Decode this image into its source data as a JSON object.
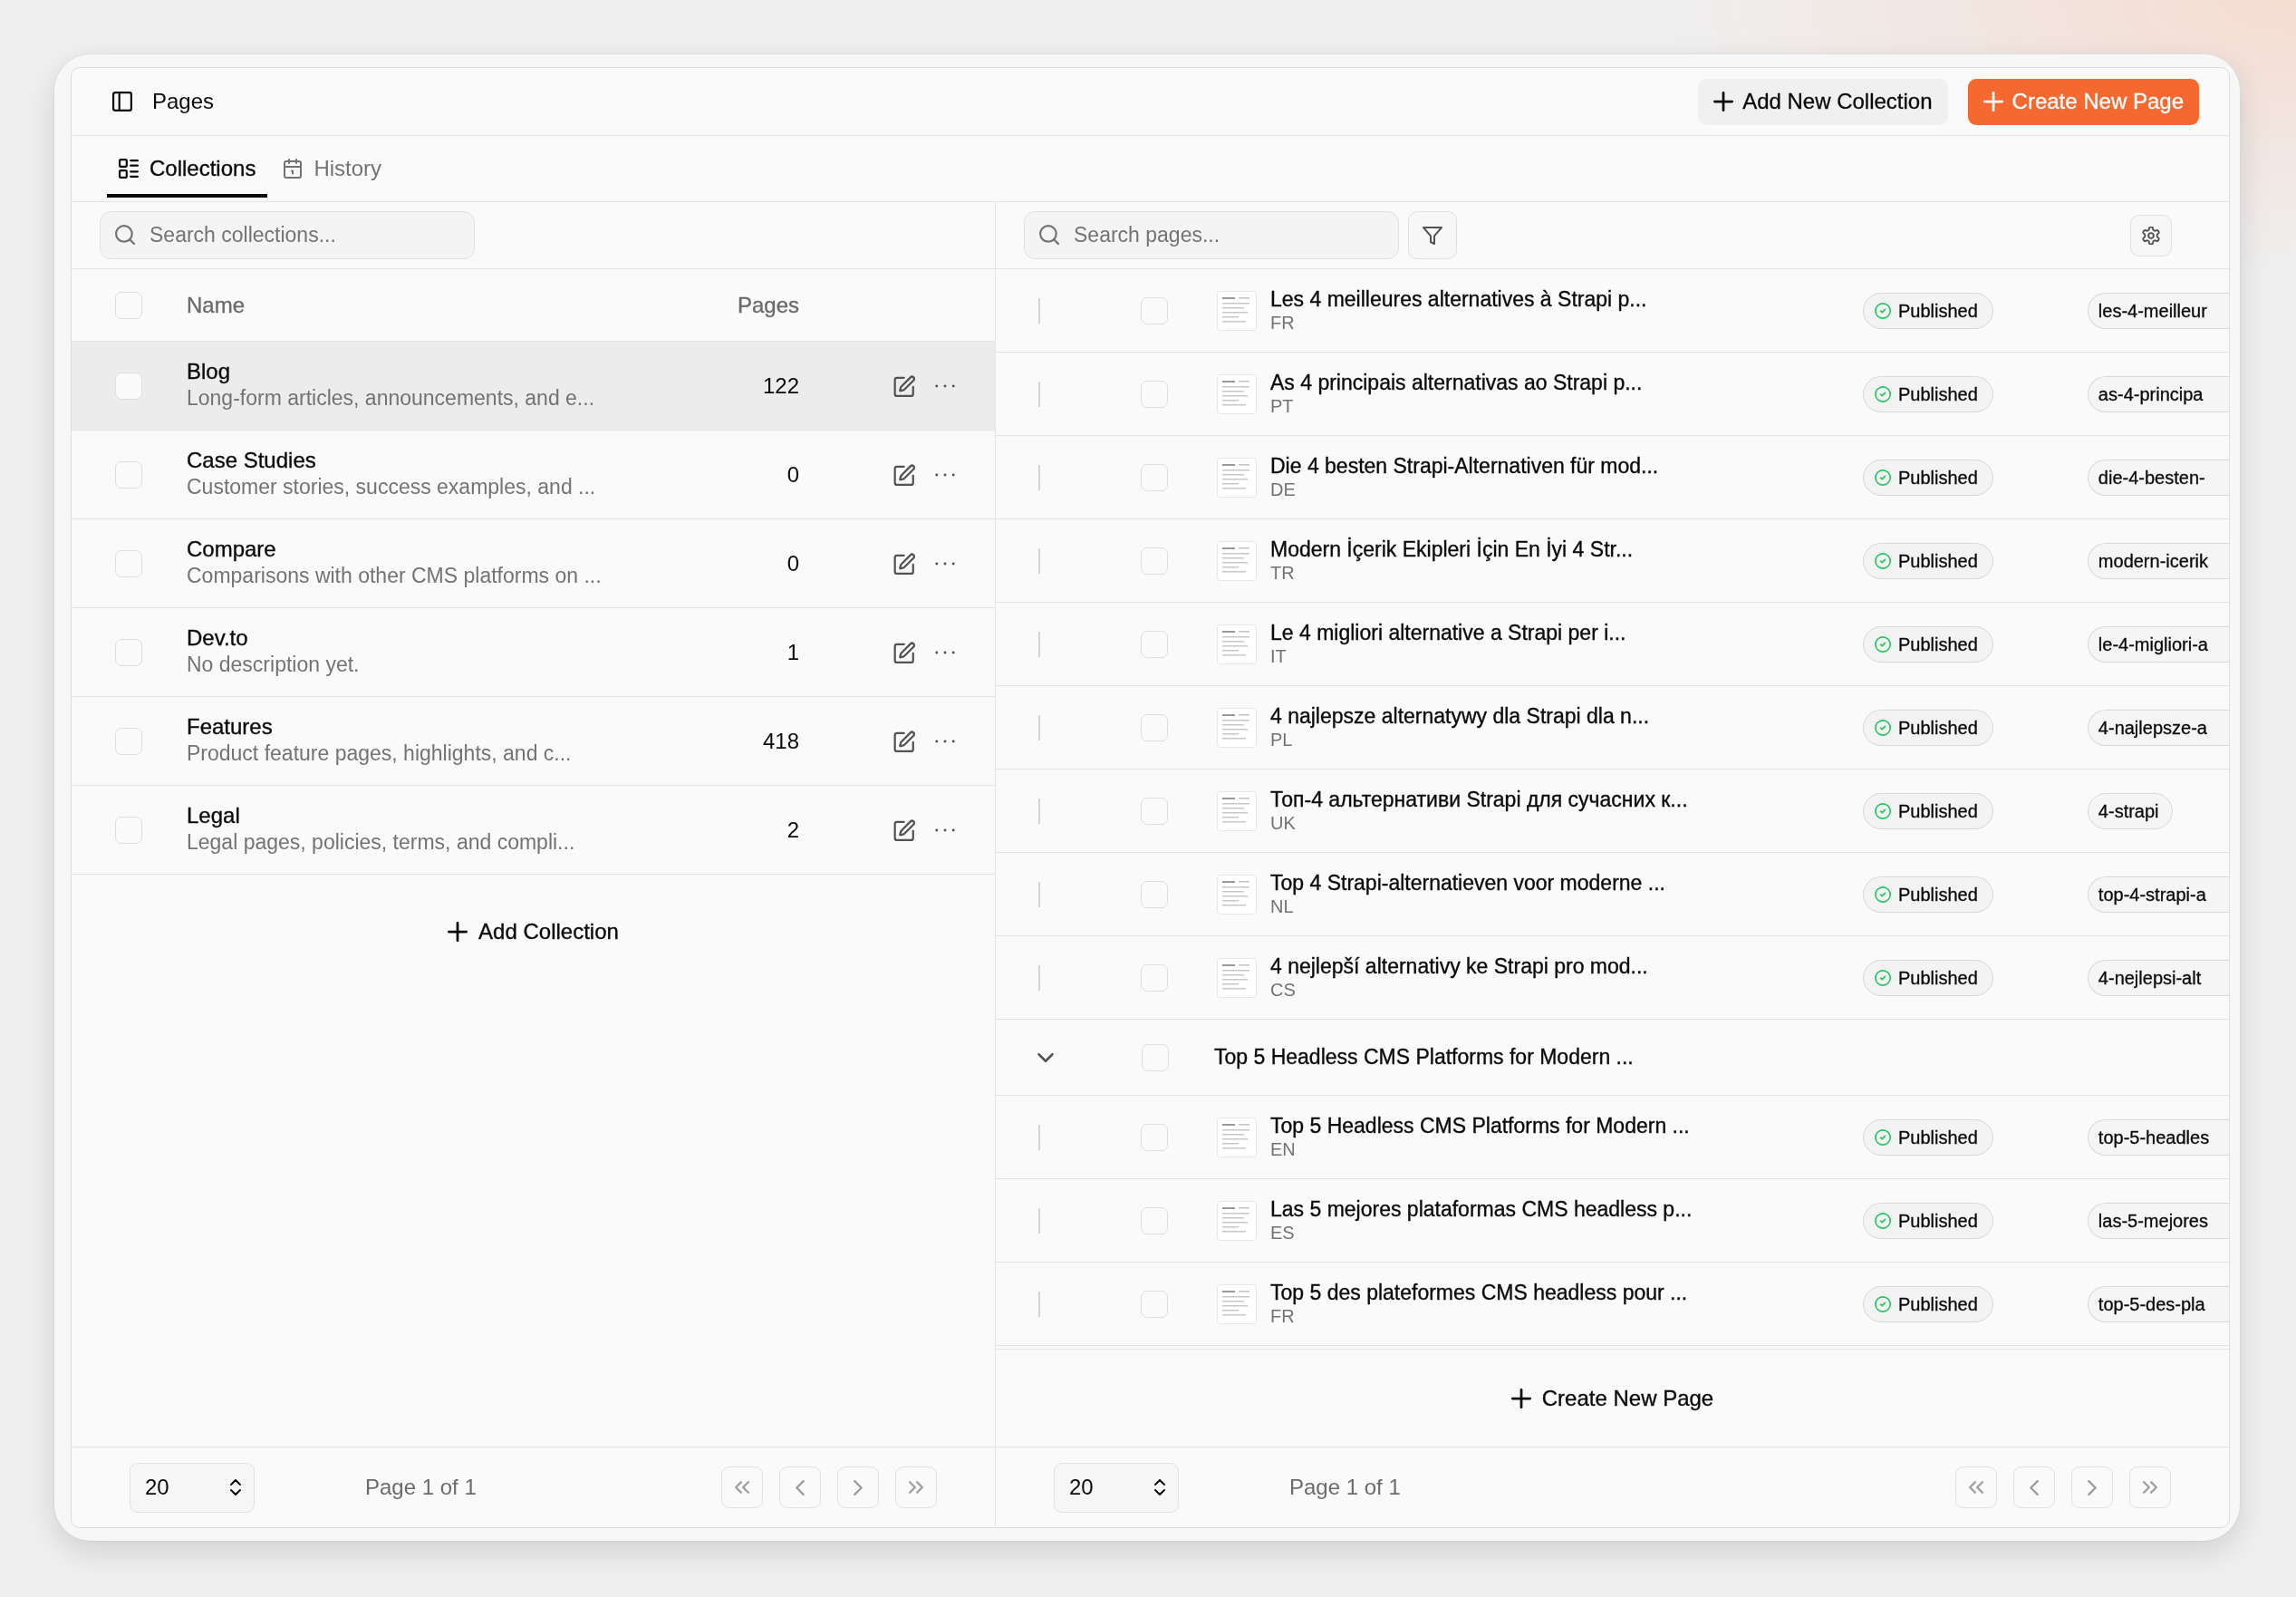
{
  "header": {
    "title": "Pages",
    "buttons": [
      {
        "label": "Add New Collection",
        "kind": "add_collection"
      },
      {
        "label": "Create New Page",
        "kind": "create_page"
      }
    ]
  },
  "tabs": [
    {
      "label": "Collections",
      "kind": "collections",
      "selected": true
    },
    {
      "label": "History",
      "kind": "history",
      "selected": false
    }
  ],
  "collections": {
    "search": {
      "placeholder": "Search collections..."
    },
    "columns": [
      "Name",
      "Pages"
    ],
    "select_all_checked": false,
    "rows": [
      {
        "name": "Blog",
        "description": "Long-form articles, announcements, and e...",
        "pages": "122",
        "checked": false,
        "highlighted": true
      },
      {
        "name": "Case Studies",
        "description": "Customer stories, success examples, and ...",
        "pages": "0",
        "checked": false,
        "highlighted": false
      },
      {
        "name": "Compare",
        "description": "Comparisons with other CMS platforms on ...",
        "pages": "0",
        "checked": false,
        "highlighted": false
      },
      {
        "name": "Dev.to",
        "description": "No description yet.",
        "pages": "1",
        "checked": false,
        "highlighted": false
      },
      {
        "name": "Features",
        "description": "Product feature pages, highlights, and c...",
        "pages": "418",
        "checked": false,
        "highlighted": false
      },
      {
        "name": "Legal",
        "description": "Legal pages, policies, terms, and compli...",
        "pages": "2",
        "checked": false,
        "highlighted": false
      }
    ],
    "add_label": "Add Collection",
    "pagination": {
      "page_size": "20",
      "page_label": "Page 1 of 1",
      "buttons": [
        {
          "kind": "first",
          "disabled": true
        },
        {
          "kind": "previous",
          "disabled": true
        },
        {
          "kind": "next",
          "disabled": true
        },
        {
          "kind": "last",
          "disabled": true
        }
      ]
    }
  },
  "pages": {
    "search": {
      "placeholder": "Search pages..."
    },
    "rows": [
      {
        "kind": "page",
        "title": "Les 4 meilleures alternatives à Strapi p...",
        "lang": "FR",
        "status": "Published",
        "slug": "les-4-meilleur",
        "slug_cut": true,
        "checked": false
      },
      {
        "kind": "page",
        "title": "As 4 principais alternativas ao Strapi p...",
        "lang": "PT",
        "status": "Published",
        "slug": "as-4-principa",
        "slug_cut": true,
        "checked": false
      },
      {
        "kind": "page",
        "title": "Die 4 besten Strapi-Alternativen für mod...",
        "lang": "DE",
        "status": "Published",
        "slug": "die-4-besten-",
        "slug_cut": true,
        "checked": false
      },
      {
        "kind": "page",
        "title": "Modern İçerik Ekipleri İçin En İyi 4 Str...",
        "lang": "TR",
        "status": "Published",
        "slug": "modern-icerik",
        "slug_cut": true,
        "checked": false
      },
      {
        "kind": "page",
        "title": "Le 4 migliori alternative a Strapi per i...",
        "lang": "IT",
        "status": "Published",
        "slug": "le-4-migliori-a",
        "slug_cut": true,
        "checked": false
      },
      {
        "kind": "page",
        "title": "4 najlepsze alternatywy dla Strapi dla n...",
        "lang": "PL",
        "status": "Published",
        "slug": "4-najlepsze-a",
        "slug_cut": true,
        "checked": false
      },
      {
        "kind": "page",
        "title": "Топ-4 альтернативи Strapi для сучасних к...",
        "lang": "UK",
        "status": "Published",
        "slug": "4-strapi",
        "slug_cut": false,
        "checked": false
      },
      {
        "kind": "page",
        "title": "Top 4 Strapi-alternatieven voor moderne ...",
        "lang": "NL",
        "status": "Published",
        "slug": "top-4-strapi-a",
        "slug_cut": true,
        "checked": false
      },
      {
        "kind": "page",
        "title": "4 nejlepší alternativy ke Strapi pro mod...",
        "lang": "CS",
        "status": "Published",
        "slug": "4-nejlepsi-alt",
        "slug_cut": true,
        "checked": false
      },
      {
        "kind": "group",
        "title": "Top 5 Headless CMS Platforms for Modern ...",
        "expanded": true,
        "checked": false,
        "children": [
          {
            "kind": "page",
            "title": "Top 5 Headless CMS Platforms for Modern ...",
            "lang": "EN",
            "status": "Published",
            "slug": "top-5-headles",
            "slug_cut": true,
            "checked": false
          },
          {
            "kind": "page",
            "title": "Las 5 mejores plataformas CMS headless p...",
            "lang": "ES",
            "status": "Published",
            "slug": "las-5-mejores",
            "slug_cut": true,
            "checked": false
          },
          {
            "kind": "page",
            "title": "Top 5 des plateformes CMS headless pour ...",
            "lang": "FR",
            "status": "Published",
            "slug": "top-5-des-pla",
            "slug_cut": true,
            "checked": false
          }
        ]
      }
    ],
    "create_label": "Create New Page",
    "pagination": {
      "page_size": "20",
      "page_label": "Page 1 of 1",
      "buttons": [
        {
          "kind": "first",
          "disabled": true
        },
        {
          "kind": "previous",
          "disabled": true
        },
        {
          "kind": "next",
          "disabled": true
        },
        {
          "kind": "last",
          "disabled": true
        }
      ]
    }
  }
}
